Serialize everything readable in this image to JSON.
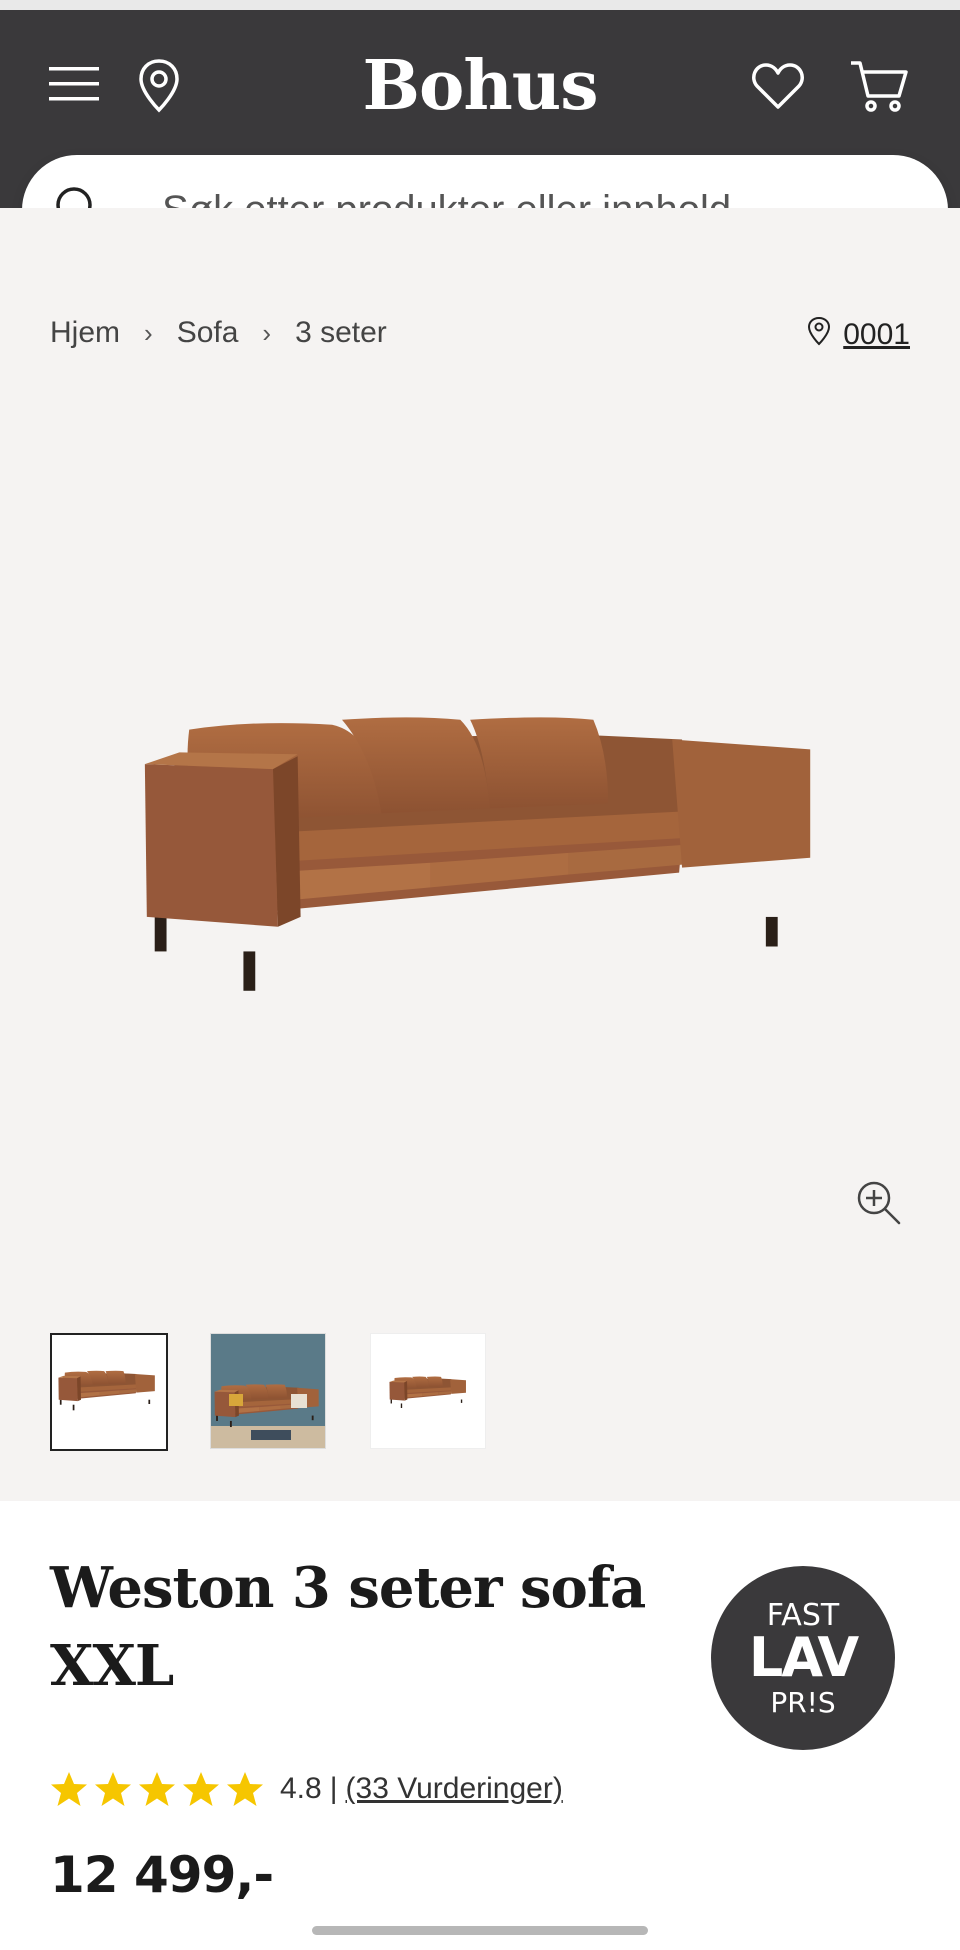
{
  "header": {
    "logo": "Bohus",
    "icons": [
      "menu-icon",
      "location-pin-icon",
      "heart-icon",
      "cart-icon"
    ]
  },
  "search": {
    "placeholder": "Søk etter produkter eller innhold..."
  },
  "breadcrumb": {
    "items": [
      "Hjem",
      "Sofa",
      "3 seter"
    ]
  },
  "store": {
    "label": "0001"
  },
  "product": {
    "title_line1": "Weston 3 seter sofa",
    "title_line2": "XXL",
    "rating_value": "4.8",
    "rating_separator": "|",
    "reviews_label": "(33 Vurderinger)",
    "stars": 5,
    "price": "12 499,-"
  },
  "badge": {
    "line1": "FAST",
    "line2": "LAV",
    "line3": "PR!S"
  },
  "colors": {
    "header_bg": "#3a393b",
    "gallery_bg": "#f5f3f2",
    "star": "#f6c600",
    "leather": "#a0603a"
  }
}
